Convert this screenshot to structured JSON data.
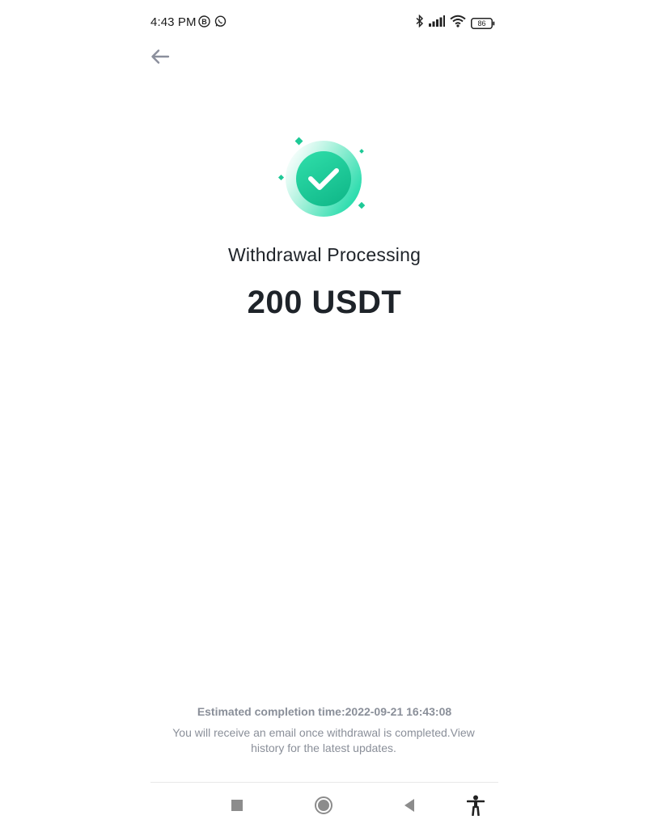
{
  "status_bar": {
    "time": "4:43 PM",
    "left_icons": [
      "b-badge-icon",
      "whatsapp-icon"
    ],
    "right_icons": [
      "bluetooth-icon",
      "signal-icon",
      "wifi-icon",
      "battery-icon"
    ],
    "battery_level": "86"
  },
  "header": {
    "back_icon": "arrow-left-icon"
  },
  "main": {
    "status_icon": "check-circle-icon",
    "title": "Withdrawal Processing",
    "amount": "200 USDT",
    "accent_color": "#1dc996"
  },
  "footer": {
    "estimate": "Estimated completion time:2022-09-21 16:43:08",
    "note": "You will receive an email once withdrawal is completed.View history for the latest updates."
  },
  "nav": {
    "icons": [
      "square-recent-icon",
      "circle-home-icon",
      "triangle-back-icon",
      "accessibility-icon"
    ]
  }
}
